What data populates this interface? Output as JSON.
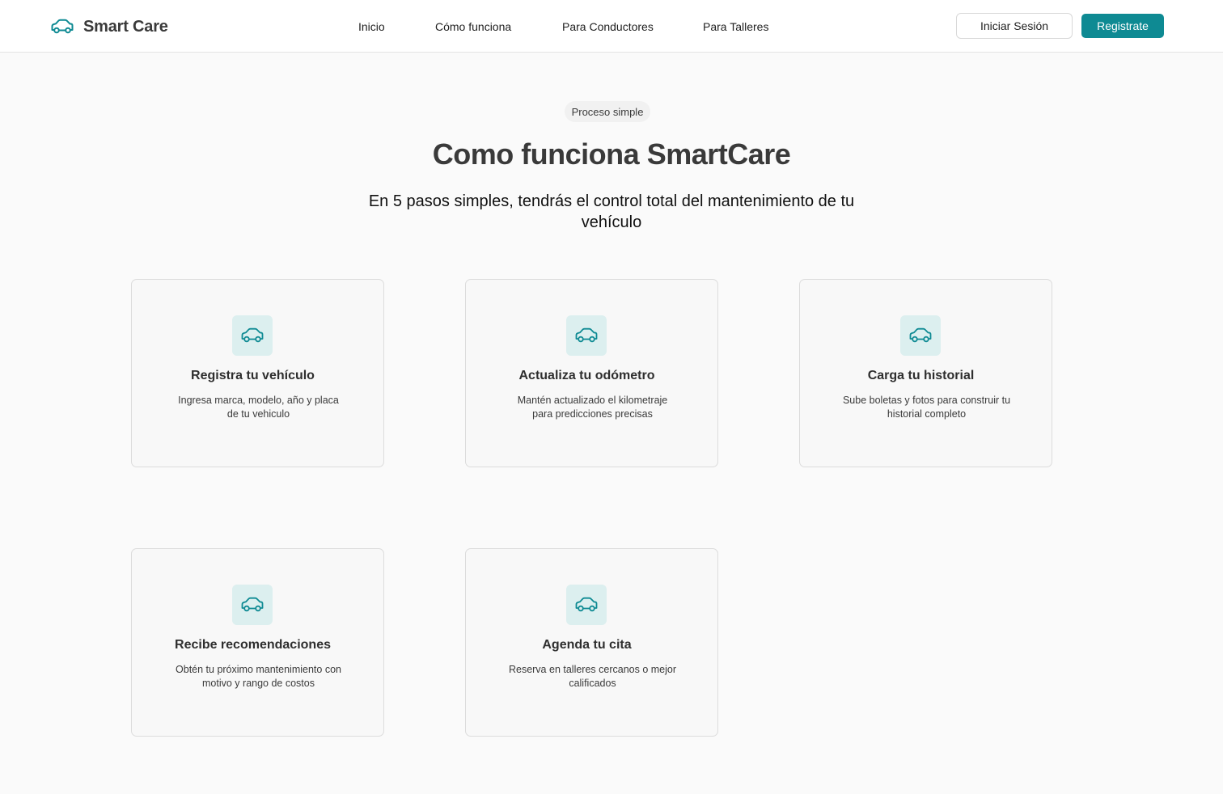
{
  "brand": {
    "name": "Smart Care",
    "icon": "car-icon",
    "accent": "#0e8a93"
  },
  "nav": {
    "items": [
      {
        "label": "Inicio"
      },
      {
        "label": "Cómo funciona"
      },
      {
        "label": "Para Conductores"
      },
      {
        "label": "Para Talleres"
      }
    ]
  },
  "auth": {
    "login_label": "Iniciar Sesión",
    "register_label": "Registrate"
  },
  "hero": {
    "badge": "Proceso simple",
    "title": "Como funciona SmartCare",
    "subtitle": "En 5 pasos simples, tendrás el control total del mantenimiento de tu vehículo"
  },
  "steps": [
    {
      "icon": "car-icon",
      "title": "Registra tu vehículo",
      "description": "Ingresa marca, modelo, año y placa de tu vehiculo"
    },
    {
      "icon": "car-icon",
      "title": "Actualiza tu odómetro",
      "description": "Mantén actualizado el kilometraje para predicciones precisas"
    },
    {
      "icon": "car-icon",
      "title": "Carga tu historial",
      "description": "Sube boletas y fotos para construir tu historial completo"
    },
    {
      "icon": "car-icon",
      "title": "Recibe recomendaciones",
      "description": "Obtén tu próximo mantenimiento con motivo y rango de costos"
    },
    {
      "icon": "car-icon",
      "title": "Agenda tu cita",
      "description": "Reserva en talleres cercanos o mejor calificados"
    }
  ]
}
